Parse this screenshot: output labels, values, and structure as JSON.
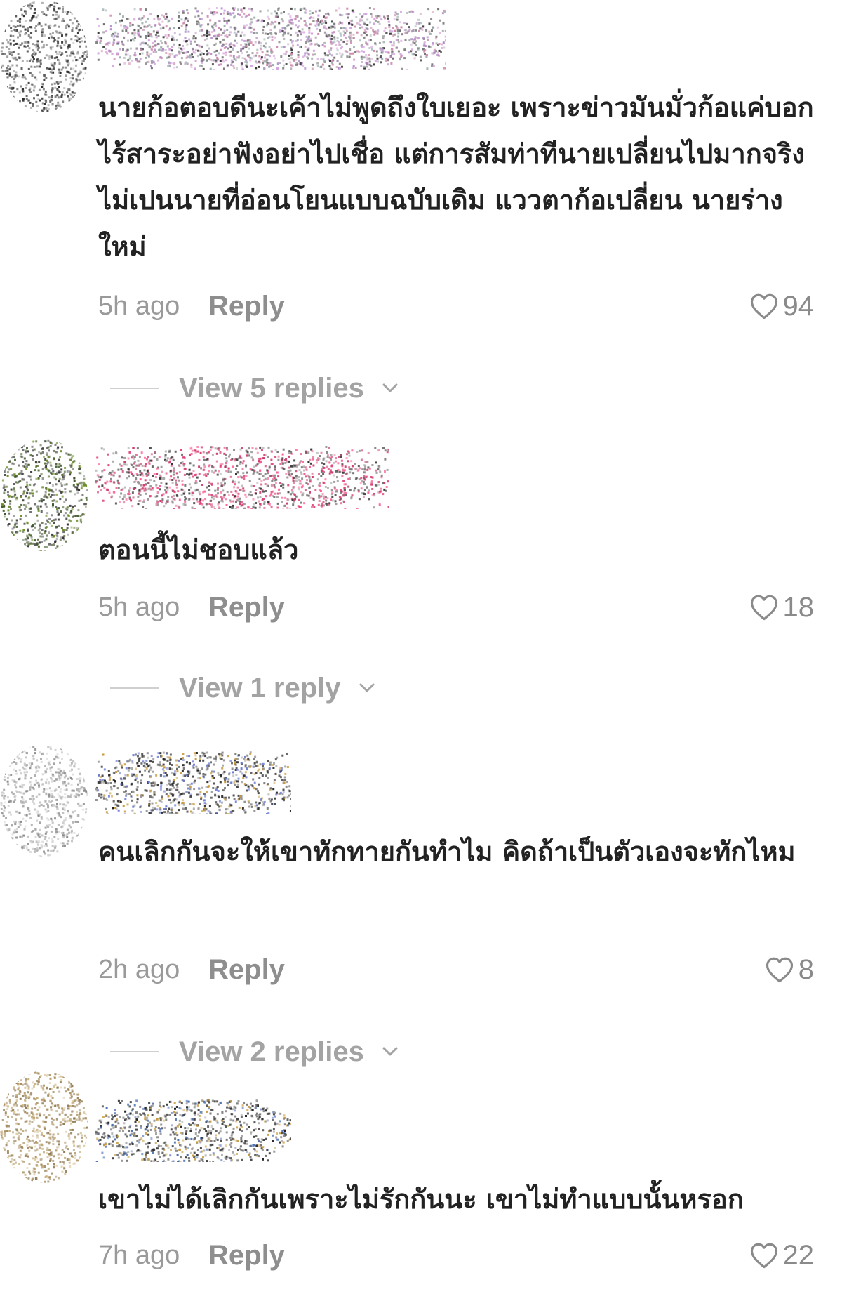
{
  "comments": [
    {
      "text": "นายก้อตอบดีนะเค้าไม่พูดถึงใบเยอะ เพราะข่าวมันมั่วก้อแค่บอกไร้สาระอย่าฟังอย่าไปเชื่อ แต่การสัมท่าทีนายเปลี่ยนไปมากจริงไม่เปนนายที่อ่อนโยนแบบฉบับเดิม แววตาก้อเปลี่ยน นายร่างใหม่",
      "timestamp": "5h ago",
      "reply_label": "Reply",
      "likes": "94",
      "view_replies": "View 5 replies"
    },
    {
      "text": "ตอนนี้ไม่ชอบแล้ว",
      "timestamp": "5h ago",
      "reply_label": "Reply",
      "likes": "18",
      "view_replies": "View 1 reply"
    },
    {
      "text": "คนเลิกกันจะให้เขาทักทายกันทำไม คิดถ้าเป็นตัวเองจะทักไหม",
      "timestamp": "2h ago",
      "reply_label": "Reply",
      "likes": "8",
      "view_replies": "View 2 replies"
    },
    {
      "text": "เขาไม่ได้เลิกกันเพราะไม่รักกันนะ เขาไม่ทำแบบนั้นหรอก",
      "timestamp": "7h ago",
      "reply_label": "Reply",
      "likes": "22"
    }
  ],
  "icons": {
    "like": "heart-outline-icon",
    "expand": "chevron-down-icon"
  },
  "colors": {
    "text": "#222222",
    "muted": "#9a9a9a",
    "reply": "#8e8e8e",
    "divider": "#cfcfcf"
  }
}
